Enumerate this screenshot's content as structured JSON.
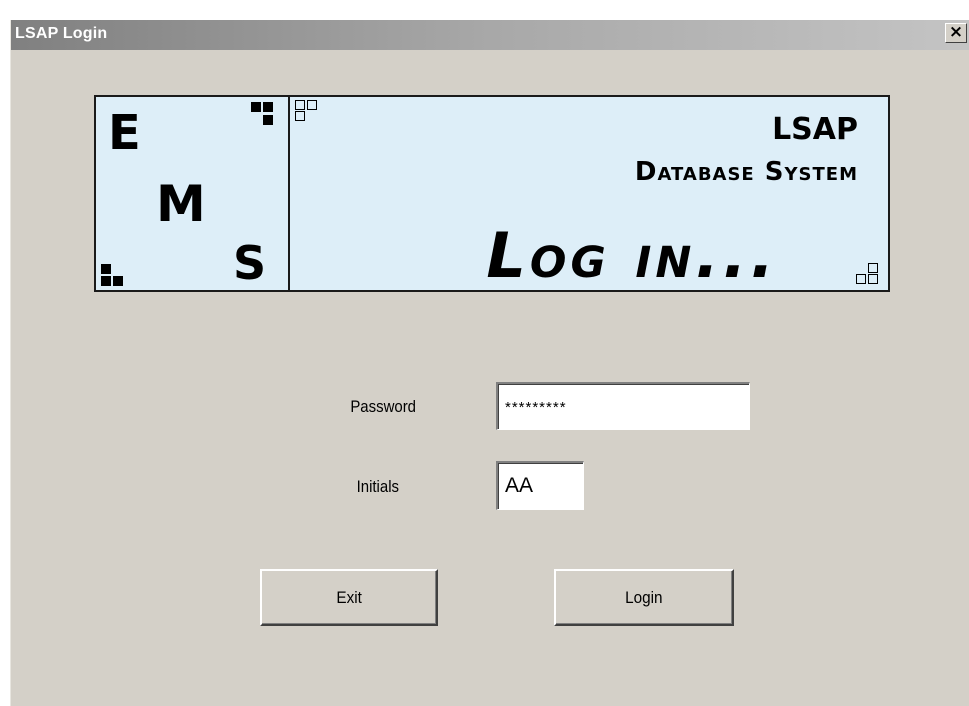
{
  "window": {
    "title": "LSAP Login",
    "close_label": "×"
  },
  "banner": {
    "logo_letters": [
      "E",
      "M",
      "S"
    ],
    "product_line1": "LSAP",
    "product_line2": "Database System",
    "heading": "Log in..."
  },
  "form": {
    "password_label": "Password",
    "password_value": "*********",
    "initials_label": "Initials",
    "initials_value": "AA"
  },
  "buttons": {
    "exit_label": "Exit",
    "login_label": "Login"
  },
  "colors": {
    "window_bg": "#d4d0c8",
    "banner_bg": "#ddeef8",
    "title_text": "#ffffff"
  }
}
